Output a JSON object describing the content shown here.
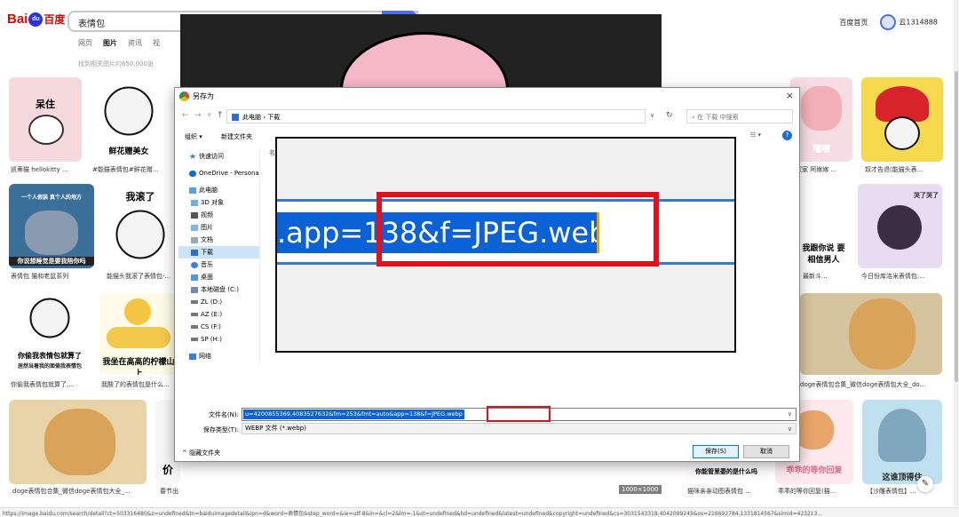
{
  "baidu": {
    "logo_bai": "Bai",
    "logo_du": "du",
    "logo_cn": "百度",
    "search_query": "表情包",
    "tabs": [
      "网页",
      "图片",
      "资讯",
      "视"
    ],
    "result_count": "找到相关图片约650,000张",
    "home_link": "百度首页",
    "username": "云1314888"
  },
  "grid": {
    "captions": {
      "c1": "凯蒂猫 hellokitty ...",
      "c2": "#能猫表情包#鲜花赠...",
      "c3": "表情包 猫和老鼠系列",
      "c4": "能猫头我滚了表情包-...",
      "c5": "你偷我表情包就算了,...",
      "c6": "我酸了的表情包是什么...",
      "c7": "doge表情包合集_微信doge表情包大全_...",
      "c8": "春节出",
      "r1": "奴才告退(能猫头表...",
      "r2": "最新斗...",
      "r3": "今日份库洛米表情包:...",
      "r4": "doge表情包合集_微信doge表情包大全_do...",
      "r5": "猫咪亲亲动图表情包 ...",
      "r6": "乖乖的等你回复(猫...",
      "r7": "【沙雕表情包】...",
      "r8": "家家 阿嫁嫁 ...",
      "r9": "最新聊天表...",
      "r10": "你能管里委的是什么吗"
    },
    "meme_texts": {
      "m1": "呆住",
      "m2": "鲜花赠美女",
      "m3": "你说想睡觉是要我陪你吗",
      "m4": "我滚了",
      "m5": "你偷我表情包就算了",
      "m5b": "居然当着我的面偷我表情包",
      "m6": "我坐在高高的柠檬山上",
      "m7": "嘿嘿",
      "m8": "我跟你说 要相信男人",
      "m9": "这谁顶得住",
      "m10": "一个人假装 真个人的地方",
      "m11": "价",
      "m12": "乖乖的等你回复",
      "m13": "哭了哭了",
      "m14": "你能管里委的是什么吗"
    },
    "preview_badge": "1000×1000"
  },
  "dialog": {
    "title": "另存为",
    "close": "×",
    "address_path": "此电脑 › 下载",
    "search_placeholder": "在 下载 中搜索",
    "toolbar_organize": "组织 ▾",
    "toolbar_newfolder": "新建文件夹",
    "file_column": "名",
    "nav_items": [
      {
        "label": "快速访问",
        "icon": "star"
      },
      {
        "label": "OneDrive - Personal",
        "icon": "cloud"
      },
      {
        "label": "此电脑",
        "icon": "pc"
      },
      {
        "label": "3D 对象",
        "icon": "cube"
      },
      {
        "label": "视频",
        "icon": "video"
      },
      {
        "label": "图片",
        "icon": "picture"
      },
      {
        "label": "文档",
        "icon": "doc"
      },
      {
        "label": "下载",
        "icon": "download"
      },
      {
        "label": "音乐",
        "icon": "music"
      },
      {
        "label": "桌面",
        "icon": "desktop"
      },
      {
        "label": "本地磁盘 (C:)",
        "icon": "drive"
      },
      {
        "label": "ZL (D:)",
        "icon": "drive"
      },
      {
        "label": "AZ (E:)",
        "icon": "drive"
      },
      {
        "label": "CS (F:)",
        "icon": "drive"
      },
      {
        "label": "SP (H:)",
        "icon": "drive"
      },
      {
        "label": "网络",
        "icon": "network"
      }
    ],
    "zoom_text": ".app=138&f=JPEG.webp",
    "filename_label": "文件名(N):",
    "filename_value": "u=4200855369,4083527632&fm=253&fmt=auto&app=138&f=JPEG.webp",
    "savetype_label": "保存类型(T):",
    "savetype_value": "WEBP 文件 (*.webp)",
    "hide_folders": "隐藏文件夹",
    "save_button": "保存(S)",
    "cancel_button": "取消"
  },
  "status_url": "https://image.baidu.com/search/detail?ct=503316480&z=undefined&tn=baiduimagedetail&ipn=d&word=表情包&step_word=&ie=utf-8&in=&cl=2&lm=-1&st=undefined&hd=undefined&latest=undefined&copyright=undefined&cs=3031543318,4042099245&os=216692784,1331814567&simid=423213...",
  "colors": {
    "baidu_red": "#e10601",
    "baidu_blue": "#4e6ef2",
    "selection_blue": "#0a62d6",
    "highlight_red": "#e0111c"
  }
}
